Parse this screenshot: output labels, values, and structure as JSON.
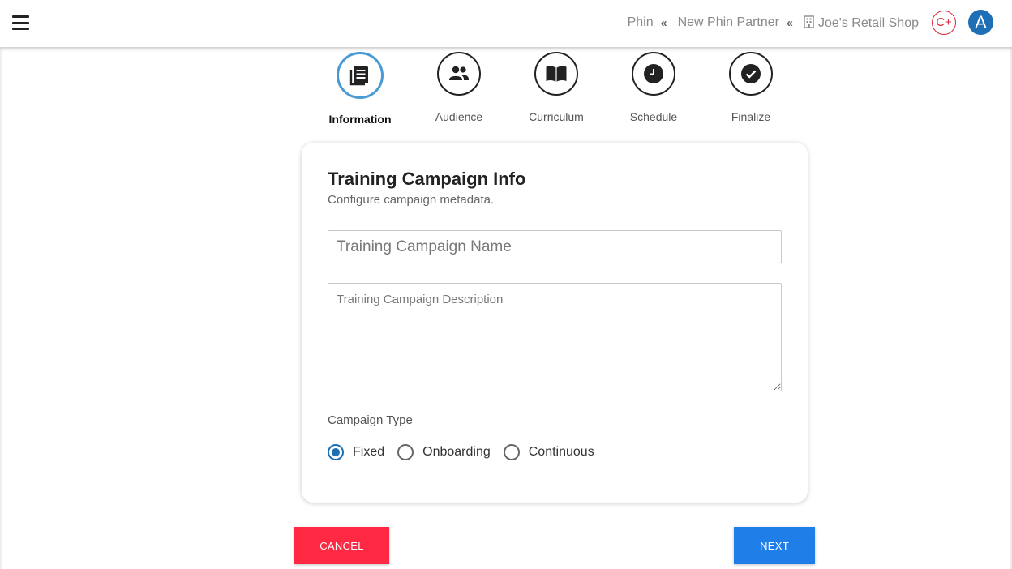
{
  "topbar": {
    "breadcrumbs": [
      {
        "label": "Phin"
      },
      {
        "label": "New Phin Partner"
      },
      {
        "label": "Joe's Retail Shop"
      }
    ],
    "notification_badge": "C+",
    "avatar_initial": "A"
  },
  "stepper": {
    "steps": [
      {
        "label": "Information",
        "icon": "article-icon",
        "active": true
      },
      {
        "label": "Audience",
        "icon": "people-icon",
        "active": false
      },
      {
        "label": "Curriculum",
        "icon": "book-icon",
        "active": false
      },
      {
        "label": "Schedule",
        "icon": "clock-icon",
        "active": false
      },
      {
        "label": "Finalize",
        "icon": "check-circle-icon",
        "active": false
      }
    ]
  },
  "card": {
    "title": "Training Campaign Info",
    "subtitle": "Configure campaign metadata.",
    "name_field": {
      "placeholder": "Training Campaign Name",
      "value": ""
    },
    "description_field": {
      "placeholder": "Training Campaign Description",
      "value": ""
    },
    "campaign_type": {
      "label": "Campaign Type",
      "selected": "Fixed",
      "options": [
        "Fixed",
        "Onboarding",
        "Continuous"
      ]
    }
  },
  "actions": {
    "cancel_label": "CANCEL",
    "next_label": "NEXT"
  },
  "colors": {
    "accent_blue": "#1e6fb5",
    "active_step_ring": "#4a9bd4",
    "cancel_red": "#ff2944",
    "next_blue": "#1f7ee8",
    "badge_red": "#e0243b"
  }
}
